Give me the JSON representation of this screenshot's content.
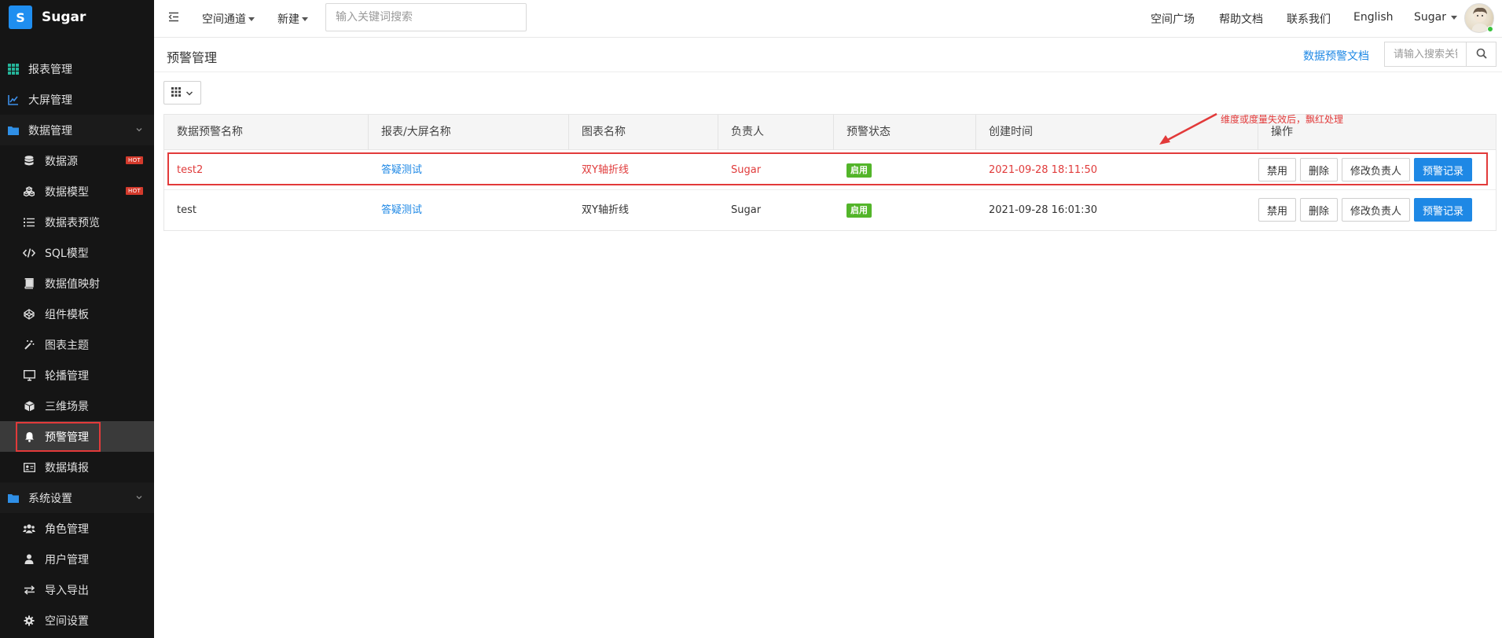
{
  "brand": {
    "logo_letter": "S",
    "name": "Sugar",
    "color": "#1f8ef0"
  },
  "sidebar": {
    "items": [
      {
        "label": "报表管理",
        "icon": "grid-icon",
        "level": "top"
      },
      {
        "label": "大屏管理",
        "icon": "line-chart-icon",
        "level": "top"
      },
      {
        "label": "数据管理",
        "icon": "folder-icon",
        "level": "group",
        "expanded": true
      },
      {
        "label": "数据源",
        "icon": "database-icon",
        "level": "sub",
        "badge": "HOT"
      },
      {
        "label": "数据模型",
        "icon": "cubes-icon",
        "level": "sub",
        "badge": "HOT"
      },
      {
        "label": "数据表预览",
        "icon": "list-icon",
        "level": "sub"
      },
      {
        "label": "SQL模型",
        "icon": "code-icon",
        "level": "sub"
      },
      {
        "label": "数据值映射",
        "icon": "book-icon",
        "level": "sub"
      },
      {
        "label": "组件模板",
        "icon": "codepen-icon",
        "level": "sub"
      },
      {
        "label": "图表主题",
        "icon": "magic-wand-icon",
        "level": "sub"
      },
      {
        "label": "轮播管理",
        "icon": "monitor-icon",
        "level": "sub"
      },
      {
        "label": "三维场景",
        "icon": "cube-icon",
        "level": "sub"
      },
      {
        "label": "预警管理",
        "icon": "bell-icon",
        "level": "sub",
        "active": true
      },
      {
        "label": "数据填报",
        "icon": "id-card-icon",
        "level": "sub"
      },
      {
        "label": "系统设置",
        "icon": "folder-icon",
        "level": "group",
        "expanded": true
      },
      {
        "label": "角色管理",
        "icon": "users-icon",
        "level": "sub"
      },
      {
        "label": "用户管理",
        "icon": "user-icon",
        "level": "sub"
      },
      {
        "label": "导入导出",
        "icon": "exchange-icon",
        "level": "sub"
      },
      {
        "label": "空间设置",
        "icon": "gear-icon",
        "level": "sub"
      }
    ]
  },
  "header": {
    "menu_space": "空间通道",
    "menu_new": "新建",
    "search_placeholder": "输入关键词搜索",
    "links": [
      "空间广场",
      "帮助文档",
      "联系我们",
      "English"
    ],
    "user": "Sugar"
  },
  "page": {
    "title": "预警管理",
    "doc_link": "数据预警文档",
    "search_placeholder": "请输入搜索关键词"
  },
  "table": {
    "headers": [
      "数据预警名称",
      "报表/大屏名称",
      "图表名称",
      "负责人",
      "预警状态",
      "创建时间",
      "操作"
    ],
    "rows": [
      {
        "name": "test2",
        "report": "答疑测试",
        "chart": "双Y轴折线",
        "owner": "Sugar",
        "status": "启用",
        "created": "2021-09-28 18:11:50",
        "highlight": true
      },
      {
        "name": "test",
        "report": "答疑测试",
        "chart": "双Y轴折线",
        "owner": "Sugar",
        "status": "启用",
        "created": "2021-09-28 16:01:30",
        "highlight": false
      }
    ],
    "actions": {
      "disable": "禁用",
      "delete": "删除",
      "change_owner": "修改负责人",
      "records": "预警记录"
    }
  },
  "annotation": {
    "text": "维度或度量失效后，飘红处理",
    "color": "#e23a3a"
  },
  "colors": {
    "primary": "#1e88e5",
    "danger": "#e03b3b",
    "success": "#53b52a",
    "sidebar_bg": "#151515"
  }
}
